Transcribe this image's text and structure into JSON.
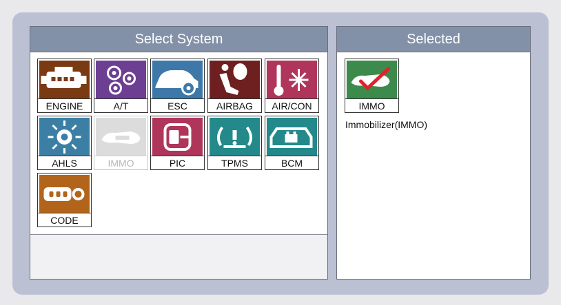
{
  "left_panel": {
    "title": "Select System",
    "systems": [
      {
        "label": "ENGINE",
        "icon": "engine-icon",
        "color": "#7a3a12"
      },
      {
        "label": "A/T",
        "icon": "gears-icon",
        "color": "#6c3f93"
      },
      {
        "label": "ESC",
        "icon": "car-brake-icon",
        "color": "#3d78a8"
      },
      {
        "label": "AIRBAG",
        "icon": "airbag-icon",
        "color": "#6e1f1f"
      },
      {
        "label": "AIR/CON",
        "icon": "aircon-icon",
        "color": "#b0355a"
      },
      {
        "label": "AHLS",
        "icon": "headlamp-icon",
        "color": "#3b7fa4"
      },
      {
        "label": "IMMO",
        "icon": "key-icon",
        "color": "#dcdcdc",
        "disabled": true
      },
      {
        "label": "PIC",
        "icon": "smart-key-icon",
        "color": "#b0355a"
      },
      {
        "label": "TPMS",
        "icon": "tire-pressure-icon",
        "color": "#23898a"
      },
      {
        "label": "BCM",
        "icon": "body-control-icon",
        "color": "#23898a"
      },
      {
        "label": "CODE",
        "icon": "key-fob-icon",
        "color": "#b2641b"
      }
    ]
  },
  "right_panel": {
    "title": "Selected",
    "selected": {
      "label": "IMMO",
      "icon": "key-check-icon",
      "color": "#3c8a4c",
      "description": "Immobilizer(IMMO)"
    }
  }
}
